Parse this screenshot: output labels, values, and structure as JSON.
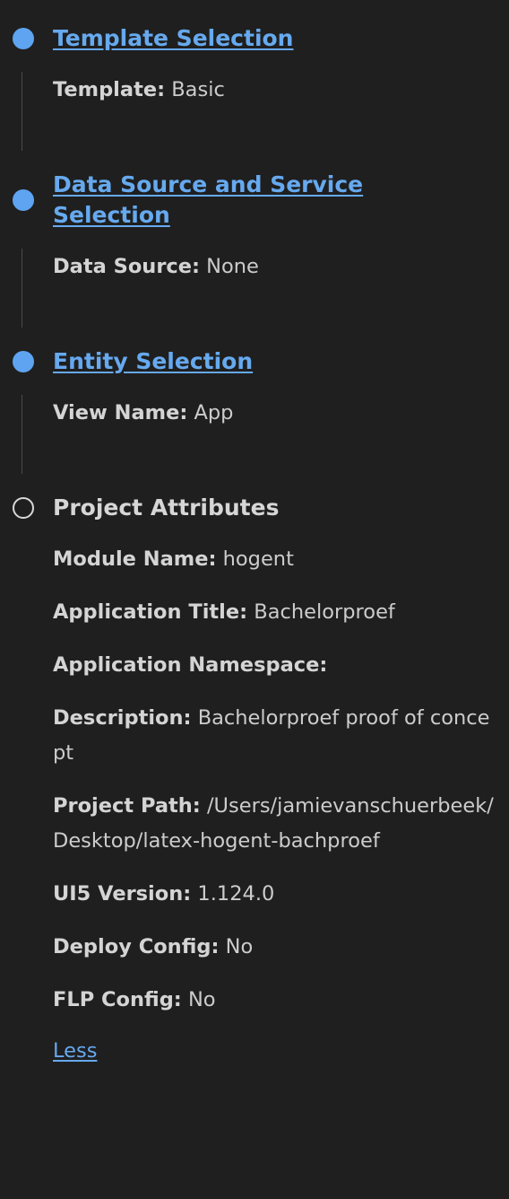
{
  "steps": [
    {
      "title": "Template Selection",
      "status": "completed",
      "fields": [
        {
          "key": "Template:",
          "value": "Basic"
        }
      ]
    },
    {
      "title_line1": "Data Source and Service",
      "title_line2": "Selection",
      "status": "completed",
      "fields": [
        {
          "key": "Data Source:",
          "value": "None"
        }
      ]
    },
    {
      "title": "Entity Selection",
      "status": "completed",
      "fields": [
        {
          "key": "View Name:",
          "value": "App"
        }
      ]
    },
    {
      "title": "Project Attributes",
      "status": "current",
      "fields": [
        {
          "key": "Module Name:",
          "value": "hogent"
        },
        {
          "key": "Application Title:",
          "value": "Bachelorproef"
        },
        {
          "key": "Application Namespace:",
          "value": ""
        },
        {
          "key": "Description:",
          "value": "Bachelorproef proof of concept"
        },
        {
          "key": "Project Path:",
          "value": "/Users/jamievanschuerbeek/Desktop/latex-hogent-bachproef"
        },
        {
          "key": "UI5 Version:",
          "value": "1.124.0"
        },
        {
          "key": "Deploy Config:",
          "value": "No"
        },
        {
          "key": "FLP Config:",
          "value": "No"
        }
      ],
      "toggle_label": "Less"
    }
  ],
  "colors": {
    "background": "#1f1f1f",
    "link": "#66a9ef",
    "completed_dot": "#5ea4f0",
    "connector": "#4a4a4a"
  }
}
